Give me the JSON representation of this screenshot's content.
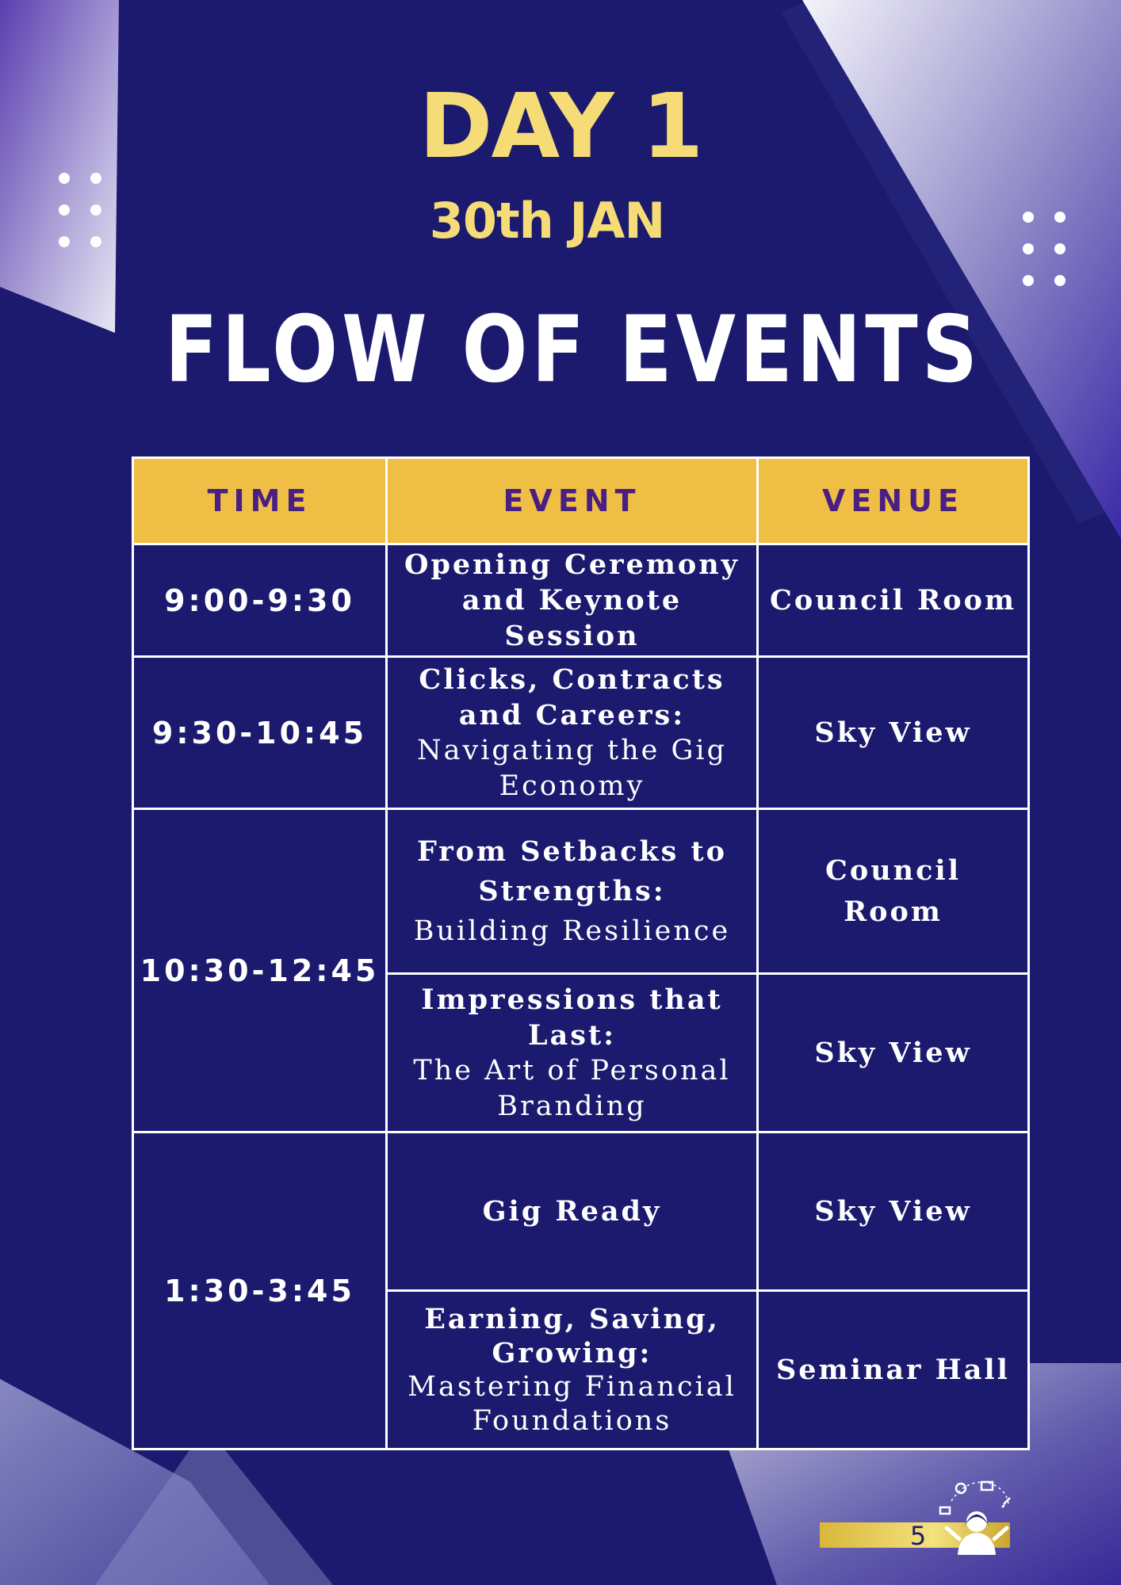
{
  "header": {
    "day": "DAY 1",
    "date": "30th JAN",
    "title": "FLOW OF EVENTS"
  },
  "table": {
    "columns": [
      "TIME",
      "EVENT",
      "VENUE"
    ],
    "rows": [
      {
        "time": "9:00-9:30",
        "event_title": "Opening Ceremony and Keynote Session",
        "event_sub": "",
        "venue": "Council Room"
      },
      {
        "time": "9:30-10:45",
        "event_title": "Clicks, Contracts and Careers:",
        "event_sub": "Navigating the Gig Economy",
        "venue": "Sky View"
      },
      {
        "time": "10:30-12:45",
        "event_title": "From Setbacks to Strengths:",
        "event_sub": "Building Resilience",
        "venue": "Council Room"
      },
      {
        "time": "",
        "event_title": "Impressions that Last:",
        "event_sub": "The Art of Personal Branding",
        "venue": "Sky View"
      },
      {
        "time": "1:30-3:45",
        "event_title": "Gig Ready",
        "event_sub": "",
        "venue": "Sky View"
      },
      {
        "time": "",
        "event_title": "Earning, Saving, Growing:",
        "event_sub": "Mastering Financial Foundations",
        "venue": "Seminar Hall"
      }
    ]
  },
  "footer": {
    "page_number": "5",
    "mascot_icon": "person-juggling-tasks-icon"
  },
  "colors": {
    "background": "#1b1a6e",
    "accent_yellow": "#f5dc77",
    "header_fill": "#efbf45",
    "header_text": "#4a1f83"
  }
}
